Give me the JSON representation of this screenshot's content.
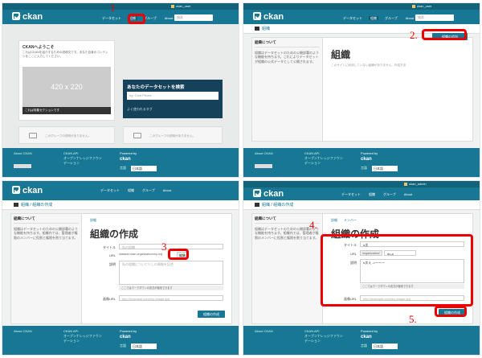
{
  "common": {
    "brand": "ckan",
    "user": "ckan_user",
    "user_admin": "ckan_admin",
    "nav": [
      "データセット",
      "組織",
      "グループ",
      "About"
    ],
    "search_placeholder": "検索",
    "footer": {
      "about": "About CKAN",
      "api": "CKAN API",
      "foundation": "オープンナレッジファウンデーション",
      "powered_by": "Powered by",
      "lang_label": "言語",
      "lang_value": "日本語"
    }
  },
  "steps": [
    "1",
    "2.",
    "3",
    "4.",
    "5."
  ],
  "panel1": {
    "welcome_title": "CKANへようこそ",
    "welcome_text": "これはCKANを紹介するための説明文です。あなた自身のコンテンツをここに入力してください。",
    "image_placeholder": "420 x 220",
    "image_caption": "これは特集セクションです",
    "search_title": "あなたのデータセットを検索",
    "search_placeholder": "eg. Gold Prices",
    "popular_tags": "よく使われるタグ",
    "empty_group": "このグループの説明がありません。",
    "empty_org": "このグループの説明がありません。"
  },
  "panel2": {
    "breadcrumb": "組織",
    "aside_title": "組織について",
    "aside_text": "組織はデータセットのための公開部署のような機能を持ちます。これによりデータセットが組織の公式データとして公開されます。",
    "add_button": "組織の追加",
    "title": "組織",
    "empty": "このサイトに利用していない組織がありません。作成方法"
  },
  "panel3": {
    "breadcrumb": [
      "組織",
      "組織の作成"
    ],
    "aside_title": "組織について",
    "aside_text": "組織はデータセットのための公開部署のような機能を持ちます。組織内では、管理者が権限のメンバーに役割と権限を割り当てます。",
    "tab": "詳細",
    "title": "組織の作成",
    "name_label": "タイトル",
    "name_placeholder": "私の組織",
    "url_label": "URL",
    "url_value": "/dataset.ckan.organization/my-org",
    "edit_button": "編集",
    "desc_label": "説明",
    "desc_placeholder": "私の組織について少しの情報を記述",
    "markdown_hint": "ここではマークダウンの書式が使用できます",
    "image_label": "画像URL",
    "image_placeholder": "http://example.com/my-image.jpg",
    "create_button": "組織の作成"
  },
  "panel4": {
    "breadcrumb": [
      "組織",
      "組織の作成"
    ],
    "aside_title": "組織について",
    "aside_text": "組織はデータセットのための公開部署のような機能を持ちます。組織内では、管理者が権限のメンバーに役割と権限を割り当てます。",
    "tabs": [
      "詳細",
      "メンバー"
    ],
    "title": "組織の作成",
    "name_label": "タイトル",
    "name_value": "n次",
    "url_label": "URL",
    "url_prefix": "/organization/",
    "url_value": "dx-a",
    "desc_label": "説明",
    "desc_value": "n次え ->ーーー",
    "markdown_hint": "ここではマークダウンの書式が使用できます",
    "image_label": "画像URL",
    "image_placeholder": "http://example.com/my-image.jpg",
    "create_button": "組織の作成"
  }
}
